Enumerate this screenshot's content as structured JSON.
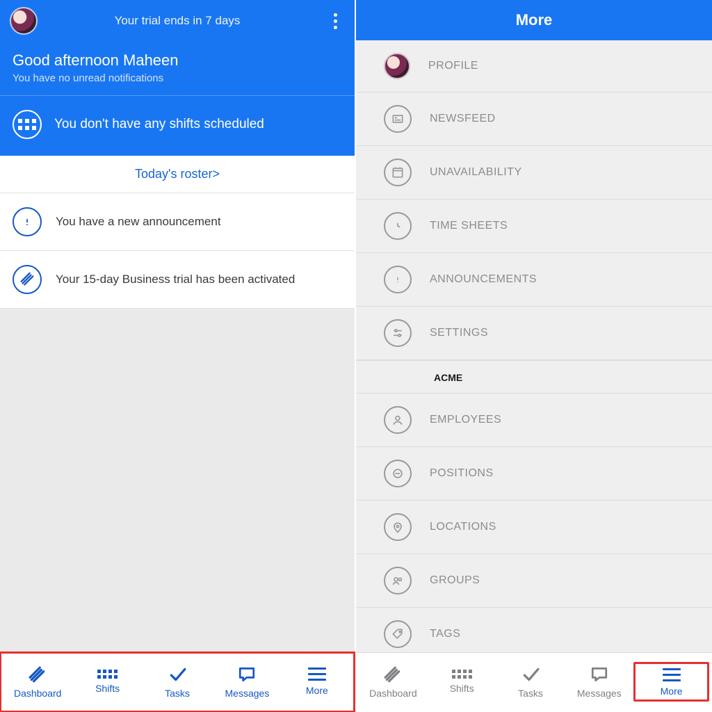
{
  "left": {
    "trial_text": "Your trial ends in 7 days",
    "greeting_title": "Good afternoon Maheen",
    "greeting_sub": "You have no unread notifications",
    "shift_empty": "You don't have any shifts scheduled",
    "roster_link": "Today's roster>",
    "announcement": "You have a new announcement",
    "trial_activated": "Your 15-day Business trial has been activated"
  },
  "right": {
    "header": "More",
    "items": [
      "PROFILE",
      "NEWSFEED",
      "UNAVAILABILITY",
      "TIME SHEETS",
      "ANNOUNCEMENTS",
      "SETTINGS"
    ],
    "section": "ACME",
    "items2": [
      "EMPLOYEES",
      "POSITIONS",
      "LOCATIONS",
      "GROUPS",
      "TAGS"
    ]
  },
  "tabs": {
    "dashboard": "Dashboard",
    "shifts": "Shifts",
    "tasks": "Tasks",
    "messages": "Messages",
    "more": "More"
  }
}
